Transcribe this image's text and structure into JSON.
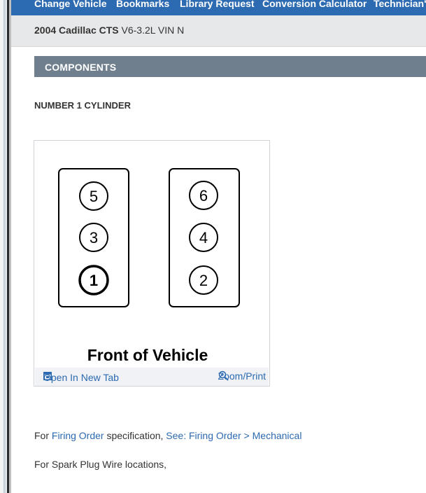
{
  "nav": {
    "items": [
      "Change Vehicle",
      "Bookmarks",
      "Library Request",
      "Conversion Calculator",
      "Technician's"
    ]
  },
  "vehicle": {
    "name": "2004 Cadillac CTS",
    "spec": "V6-3.2L VIN N"
  },
  "section": {
    "title": "COMPONENTS"
  },
  "subtitle": "NUMBER 1 CYLINDER",
  "figure": {
    "left_bank": [
      "5",
      "3",
      "1"
    ],
    "right_bank": [
      "6",
      "4",
      "2"
    ],
    "caption": "Front of Vehicle",
    "open_label": "Open In New Tab",
    "zoom_label": "Zoom/Print"
  },
  "paragraphs": {
    "firing": {
      "prefix": "For",
      "link1": "Firing Order",
      "middle": "specification,",
      "link2": "See: Firing Order > Mechanical"
    },
    "spark": {
      "text": "For Spark Plug Wire locations,"
    }
  },
  "colors": {
    "nav_bg": "#2c6ab1",
    "header_bg": "#6f7f8e",
    "link": "#2c6ab1"
  }
}
